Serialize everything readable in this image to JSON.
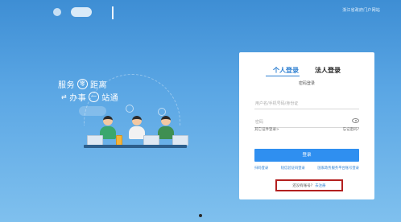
{
  "header": {
    "portal_link": "浙江省政府门户网站"
  },
  "slogan": {
    "line1": [
      "服务",
      "零",
      "距离"
    ],
    "line2": [
      "办事",
      "一",
      "站通"
    ]
  },
  "login": {
    "tabs": [
      "个人登录",
      "法人登录"
    ],
    "mode": "密码登录",
    "username_placeholder": "用户名/手机号码/身份证",
    "password_placeholder": "密码",
    "other_cert": "其它证件登录>",
    "forgot": "忘记密码?",
    "login_button": "登录",
    "alt_logins": [
      "扫码登录",
      "短信验证码登录",
      "国家政务服务平台账号登录"
    ],
    "no_account": "还没有账号?",
    "register": "去注册"
  },
  "colors": {
    "accent": "#2f8ff0",
    "highlight_border": "#b3201f"
  }
}
